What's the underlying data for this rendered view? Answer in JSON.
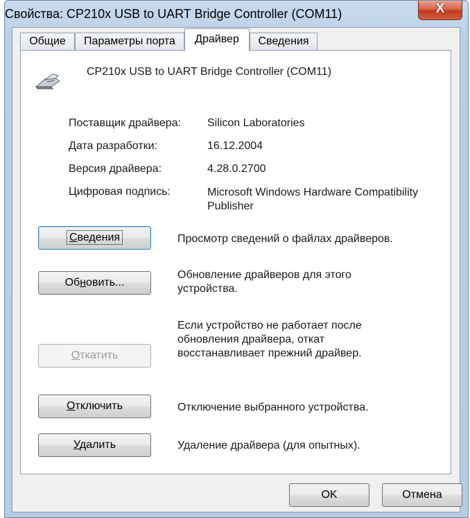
{
  "window": {
    "title": "Свойства: CP210x USB to UART Bridge Controller (COM11)",
    "close_glyph": "X"
  },
  "tabs": [
    {
      "label": "Общие",
      "active": false
    },
    {
      "label": "Параметры порта",
      "active": false
    },
    {
      "label": "Драйвер",
      "active": true
    },
    {
      "label": "Сведения",
      "active": false
    }
  ],
  "device": {
    "name": "CP210x USB to UART Bridge Controller (COM11)",
    "icon": "serial-port-cable-icon"
  },
  "info": {
    "provider_label": "Поставщик драйвера:",
    "provider_value": "Silicon Laboratories",
    "date_label": "Дата разработки:",
    "date_value": "16.12.2004",
    "version_label": "Версия драйвера:",
    "version_value": "4.28.0.2700",
    "signature_label": "Цифровая подпись:",
    "signature_value": "Microsoft Windows Hardware Compatibility Publisher"
  },
  "actions": {
    "details": {
      "pre": "",
      "ul": "С",
      "post": "ведения",
      "desc": "Просмотр сведений о файлах драйверов."
    },
    "update": {
      "pre": "Об",
      "ul": "н",
      "post": "овить...",
      "desc": "Обновление драйверов для этого устройства."
    },
    "rollback": {
      "pre": "",
      "ul": "О",
      "post": "ткатить",
      "desc": "Если устройство не работает после обновления драйвера, откат восстанавливает прежний драйвер."
    },
    "disable": {
      "pre": "",
      "ul": "О",
      "post": "тключить",
      "desc": "Отключение выбранного устройства."
    },
    "uninstall": {
      "pre": "",
      "ul": "У",
      "post": "далить",
      "desc": "Удаление драйвера (для опытных)."
    }
  },
  "footer": {
    "ok_label": "OK",
    "cancel_label": "Отмена"
  }
}
